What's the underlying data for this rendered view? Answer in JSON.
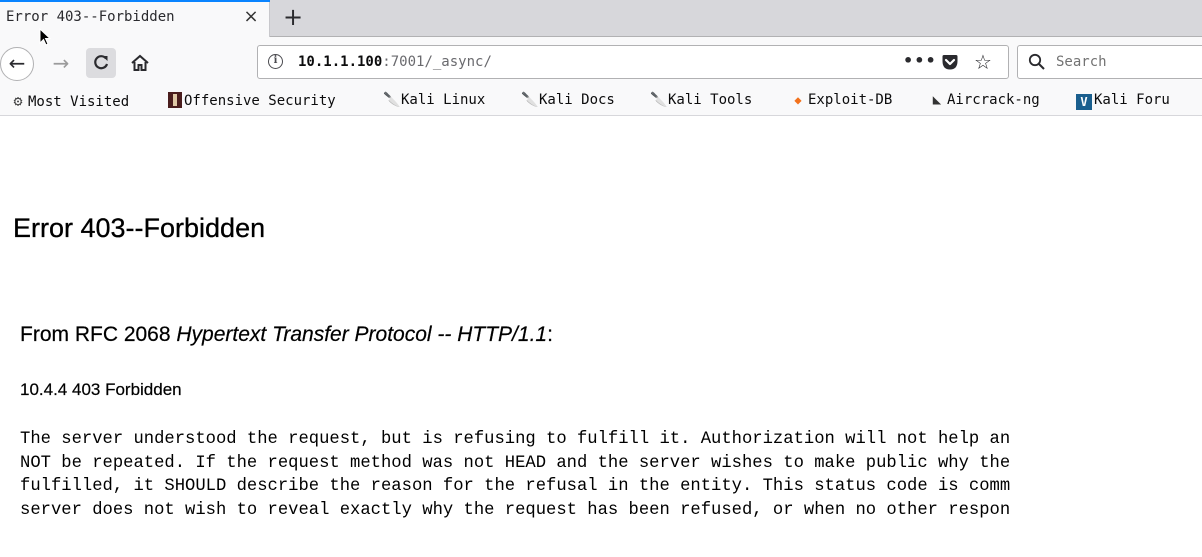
{
  "tab": {
    "title": "Error 403--Forbidden",
    "close_symbol": "×",
    "new_tab_symbol": "+"
  },
  "nav": {
    "back_symbol": "←",
    "forward_symbol": "→",
    "reload_symbol": "C",
    "url_host": "10.1.1.100",
    "url_path": ":7001/_async/",
    "more_symbol": "•••",
    "star_symbol": "☆",
    "search_placeholder": "Search"
  },
  "bookmarks": [
    {
      "label": "Most Visited",
      "icon": "gear-icon"
    },
    {
      "label": "Offensive Security",
      "icon": "offsec-icon"
    },
    {
      "label": "Kali Linux",
      "icon": "kali-dragon-icon"
    },
    {
      "label": "Kali Docs",
      "icon": "kali-dragon-icon"
    },
    {
      "label": "Kali Tools",
      "icon": "kali-dragon-icon"
    },
    {
      "label": "Exploit-DB",
      "icon": "exploit-db-icon"
    },
    {
      "label": "Aircrack-ng",
      "icon": "aircrack-icon"
    },
    {
      "label": "Kali Foru",
      "icon": "kali-forum-icon"
    }
  ],
  "page": {
    "heading": "Error 403--Forbidden",
    "rfc_prefix": "From RFC 2068 ",
    "rfc_title": "Hypertext Transfer Protocol -- HTTP/1.1",
    "rfc_suffix": ":",
    "section": "10.4.4 403 Forbidden",
    "body_lines": [
      "The server understood the request, but is refusing to fulfill it. Authorization will not help an",
      "NOT be repeated. If the request method was not HEAD and the server wishes to make public why the",
      "fulfilled, it SHOULD describe the reason for the refusal in the entity. This status code is comm",
      "server does not wish to reveal exactly why the request has been refused, or when no other respon"
    ]
  }
}
